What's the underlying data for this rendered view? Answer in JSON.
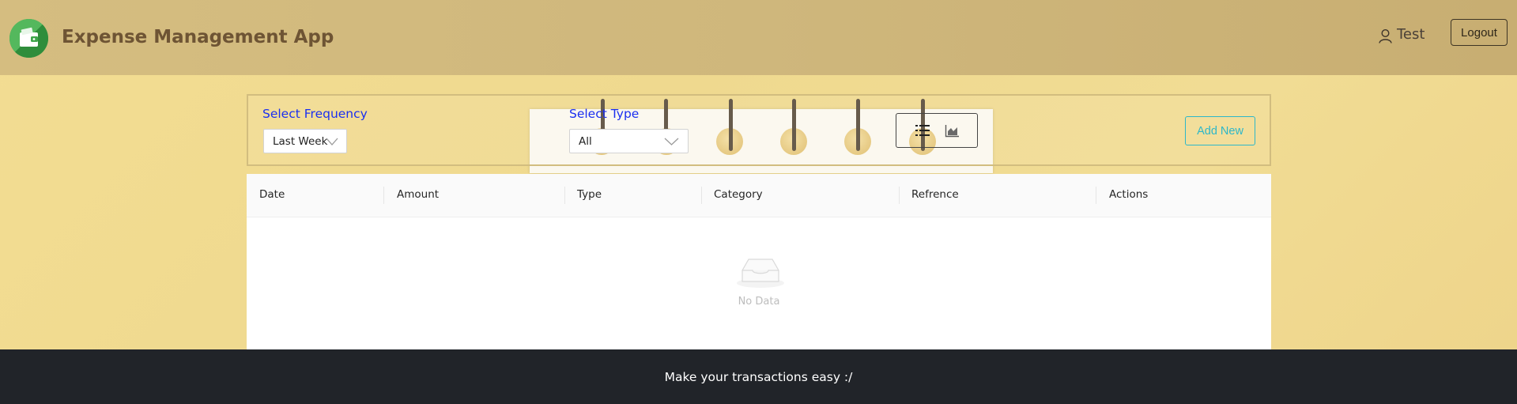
{
  "header": {
    "app_title": "Expense Management App",
    "user_name": "Test",
    "logout_label": "Logout"
  },
  "filters": {
    "frequency_label": "Select Frequency",
    "frequency_value": "Last Week",
    "type_label": "Select Type",
    "type_value": "All",
    "add_new_label": "Add New",
    "view_modes": [
      "list-icon",
      "area-chart-icon"
    ]
  },
  "table": {
    "columns": [
      "Date",
      "Amount",
      "Type",
      "Category",
      "Refrence",
      "Actions"
    ],
    "rows": [],
    "empty_text": "No Data"
  },
  "footer": {
    "text": "Make your transactions easy :/"
  },
  "colors": {
    "background": "#f1dc94",
    "header": "#cfb77c",
    "title": "#6e5434",
    "label_blue": "#1a2ff0",
    "accent": "#2db7c9",
    "footer": "#212429"
  }
}
